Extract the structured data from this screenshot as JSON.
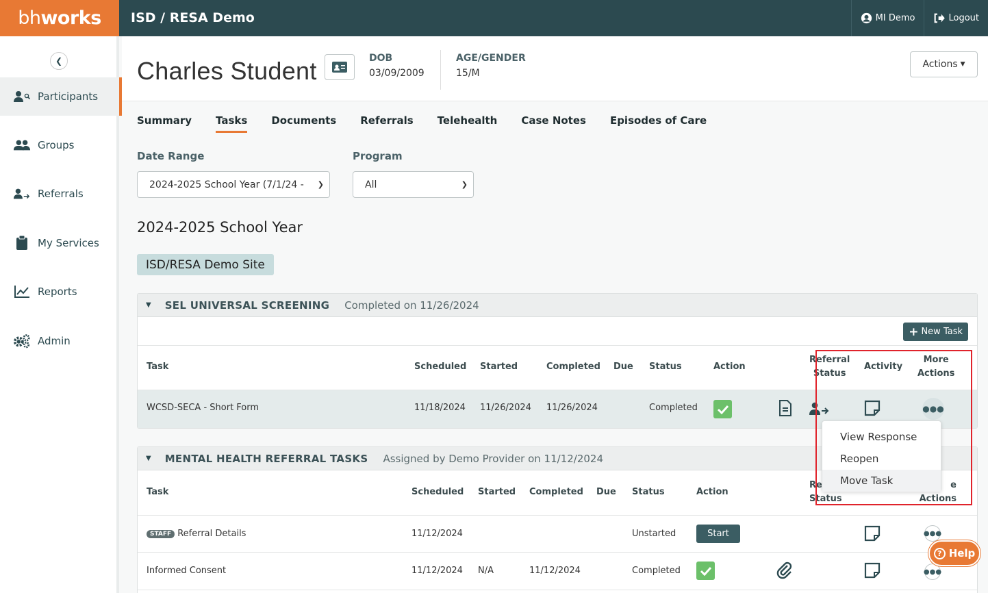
{
  "brand": {
    "bold": "bh",
    "rest": "works"
  },
  "app_title": "ISD / RESA Demo",
  "user": {
    "name": "MI Demo",
    "logout": "Logout"
  },
  "sidebar": {
    "items": [
      {
        "label": "Participants"
      },
      {
        "label": "Groups"
      },
      {
        "label": "Referrals"
      },
      {
        "label": "My Services"
      },
      {
        "label": "Reports"
      },
      {
        "label": "Admin"
      }
    ]
  },
  "participant": {
    "name": "Charles Student",
    "dob_label": "DOB",
    "dob": "03/09/2009",
    "age_gender_label": "AGE/GENDER",
    "age_gender": "15/M",
    "actions_label": "Actions"
  },
  "tabs": [
    "Summary",
    "Tasks",
    "Documents",
    "Referrals",
    "Telehealth",
    "Case Notes",
    "Episodes of Care"
  ],
  "filters": {
    "date_range_label": "Date Range",
    "date_range_value": "2024-2025 School Year (7/1/24 -",
    "program_label": "Program",
    "program_value": "All"
  },
  "year_title": "2024-2025 School Year",
  "site_pill": "ISD/RESA Demo Site",
  "panel1": {
    "title": "SEL UNIVERSAL SCREENING",
    "subtitle": "Completed on 11/26/2024",
    "new_task": "New Task",
    "headers": {
      "task": "Task",
      "scheduled": "Scheduled",
      "started": "Started",
      "completed": "Completed",
      "due": "Due",
      "status": "Status",
      "action": "Action",
      "referral1": "Referral",
      "referral2": "Status",
      "activity": "Activity",
      "more1": "More",
      "more2": "Actions"
    },
    "row": {
      "task": "WCSD-SECA - Short Form",
      "scheduled": "11/18/2024",
      "started": "11/26/2024",
      "completed": "11/26/2024",
      "status": "Completed"
    }
  },
  "dropdown": [
    "View Response",
    "Reopen",
    "Move Task"
  ],
  "panel2": {
    "title": "MENTAL HEALTH REFERRAL TASKS",
    "subtitle": "Assigned by Demo Provider on 11/12/2024",
    "headers": {
      "task": "Task",
      "scheduled": "Scheduled",
      "started": "Started",
      "completed": "Completed",
      "due": "Due",
      "status": "Status",
      "action": "Action",
      "referral1": "Ref",
      "referral2": "Status",
      "more1": "e",
      "more2": "Actions"
    },
    "rows": [
      {
        "badge": "STAFF",
        "task": "Referral Details",
        "scheduled": "11/12/2024",
        "started": "",
        "completed": "",
        "status": "Unstarted",
        "action": "Start"
      },
      {
        "task": "Informed Consent",
        "scheduled": "11/12/2024",
        "started": "N/A",
        "completed": "11/12/2024",
        "status": "Completed"
      }
    ]
  },
  "help": "Help"
}
